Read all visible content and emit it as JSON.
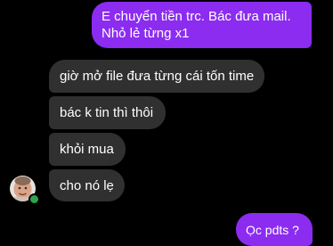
{
  "messages": [
    {
      "direction": "outgoing",
      "lines": [
        "E chuyển tiền trc. Bác đưa mail.",
        "Nhỏ lẻ từng x1"
      ]
    },
    {
      "direction": "incoming",
      "text": "giờ mở file đưa từng cái tốn time"
    },
    {
      "direction": "incoming",
      "text": "bác k tin thì thôi"
    },
    {
      "direction": "incoming",
      "text": "khỏi mua"
    },
    {
      "direction": "incoming",
      "text": "cho nó lẹ"
    },
    {
      "direction": "outgoing",
      "text": "Ọc pdts ?"
    }
  ],
  "contact": {
    "avatar_icon": "avatar-photo-icon",
    "online": true
  },
  "colors": {
    "background": "#000000",
    "outgoing_bubble": "#8b2cf0",
    "incoming_bubble": "#303030",
    "text": "#ffffff",
    "presence": "#31a24c"
  }
}
